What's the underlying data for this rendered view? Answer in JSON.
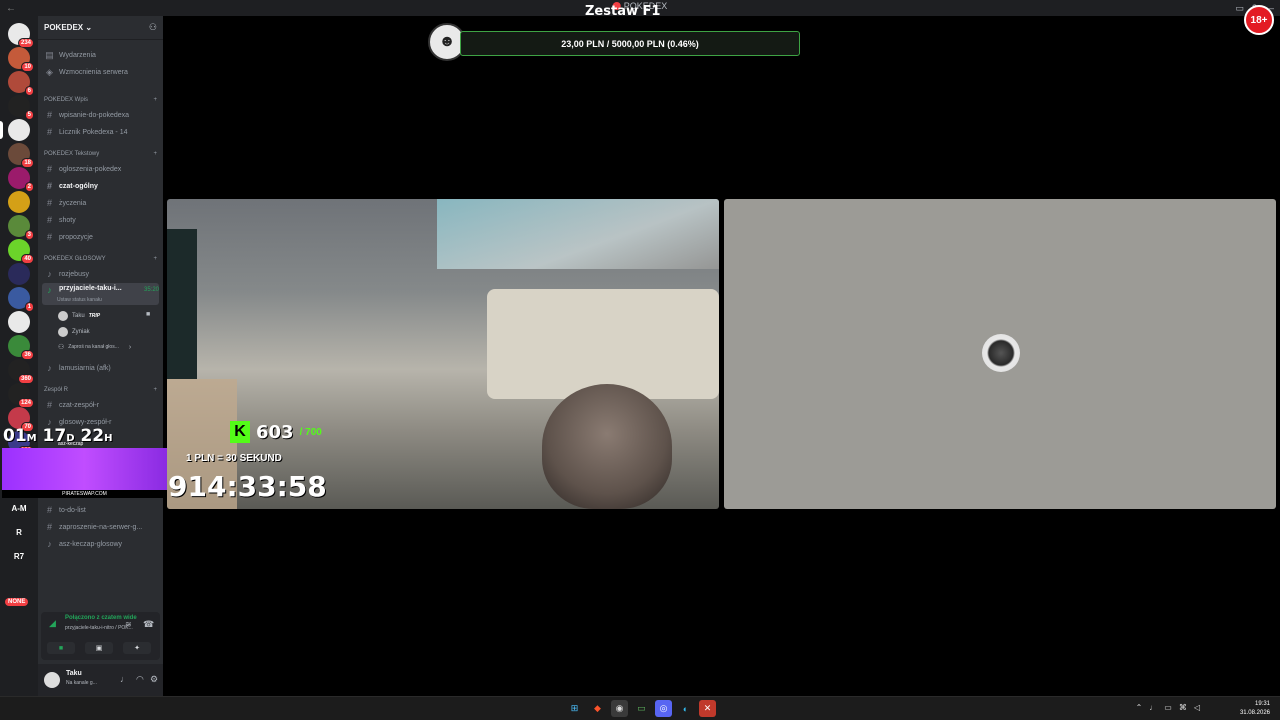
{
  "window": {
    "title_app": "POKEDEX",
    "back_arrow": "←",
    "right_icons": [
      "inbox-icon",
      "help-icon",
      "minimize-icon"
    ]
  },
  "stream": {
    "title": "Zestaw F1",
    "goal_text": "23,00 PLN / 5000,00 PLN  (0.46%)",
    "countdown_days": "01",
    "countdown_mo": "M",
    "countdown_d": "17",
    "countdown_d_unit": "D",
    "countdown_h": "22",
    "countdown_h_unit": "H",
    "countdown_small": "asz-keczap",
    "banner_text": "PIRATESWAP.COM",
    "kick_count": "603",
    "kick_goal": "/ 700",
    "rule_text": "1 PLN = 30 SEKUND",
    "timer": "914:33:58",
    "age_badge": "18+"
  },
  "rail": {
    "servers": [
      {
        "name": "server-1",
        "badge": "234",
        "color": "#e9e9e9"
      },
      {
        "name": "server-2",
        "badge": "10",
        "color": "#c45a3a"
      },
      {
        "name": "server-3",
        "badge": "6",
        "color": "#b04a3a"
      },
      {
        "name": "server-4",
        "badge": "5",
        "color": "#222222"
      },
      {
        "name": "pokedex",
        "badge": "",
        "color": "#e9e9e9"
      },
      {
        "name": "server-6",
        "badge": "18",
        "color": "#6b4a3a"
      },
      {
        "name": "server-7",
        "badge": "2",
        "color": "#9b1b6b"
      },
      {
        "name": "server-8",
        "badge": "",
        "color": "#d4a017"
      },
      {
        "name": "server-9",
        "badge": "3",
        "color": "#5a8a3a"
      },
      {
        "name": "server-10",
        "badge": "40",
        "color": "#6bd42a"
      },
      {
        "name": "server-11",
        "badge": "",
        "color": "#2a2a5a"
      },
      {
        "name": "server-12",
        "badge": "1",
        "color": "#3a5aa0"
      },
      {
        "name": "server-13",
        "badge": "",
        "color": "#e9e9e9"
      },
      {
        "name": "server-14",
        "badge": "36",
        "color": "#3a8a3a"
      },
      {
        "name": "server-15",
        "badge": "360",
        "color": "#222222"
      },
      {
        "name": "server-16",
        "badge": "124",
        "color": "#222222"
      },
      {
        "name": "server-17",
        "badge": "70",
        "color": "#c43a4a"
      },
      {
        "name": "server-18",
        "badge": "100",
        "color": "#3a3a8a"
      }
    ],
    "text_servers": [
      "A-M",
      "R",
      "R7"
    ],
    "none_badge": "NONE"
  },
  "sidebar": {
    "server_name": "POKEDEX",
    "server_chevron": "⌄",
    "top_items": [
      "Wydarzenia",
      "Wzmocnienia serwera"
    ],
    "categories": {
      "wpis": "POKEDEX Wpis",
      "tekstowy": "POKEDEX Tekstowy",
      "glosowy": "POKEDEX GŁOSOWY",
      "zespol": "Zespół R",
      "other": "asz-keczap"
    },
    "wpis_channels": [
      "wpisanie-do-pokedexa",
      "Licznik Pokedexa - 14"
    ],
    "text_channels": [
      "ogloszenia-pokedex",
      "czat-ogólny",
      "życzenia",
      "shoty",
      "propozycje"
    ],
    "voice_channels": [
      "rozjebusy"
    ],
    "active_voice": {
      "name": "przyjaciele-taku-i...",
      "time": "35:20",
      "status": "Ustaw status kanału"
    },
    "voice_users": [
      {
        "name": "Taku",
        "tag": "TRIP"
      },
      {
        "name": "Zyniak",
        "tag": ""
      }
    ],
    "invite_label": "Zaproś na kanał głos...",
    "afk_channel": "lamusiarnia (afk)",
    "zespol_channels": [
      "czat-zespół-r",
      "glosowy-zespół-r"
    ],
    "bottom_channels": [
      "to-do-list",
      "zaproszenie-na-serwer-g...",
      "asz-keczap-glosowy"
    ]
  },
  "voice_panel": {
    "title": "Połączono z czatem wide",
    "subtitle": "przyjaciele-taku-i-nitro / POK..."
  },
  "user": {
    "name": "Taku",
    "status": "Na kanale g..."
  },
  "taskbar": {
    "time": "19:31",
    "date": "31.08.2026"
  }
}
